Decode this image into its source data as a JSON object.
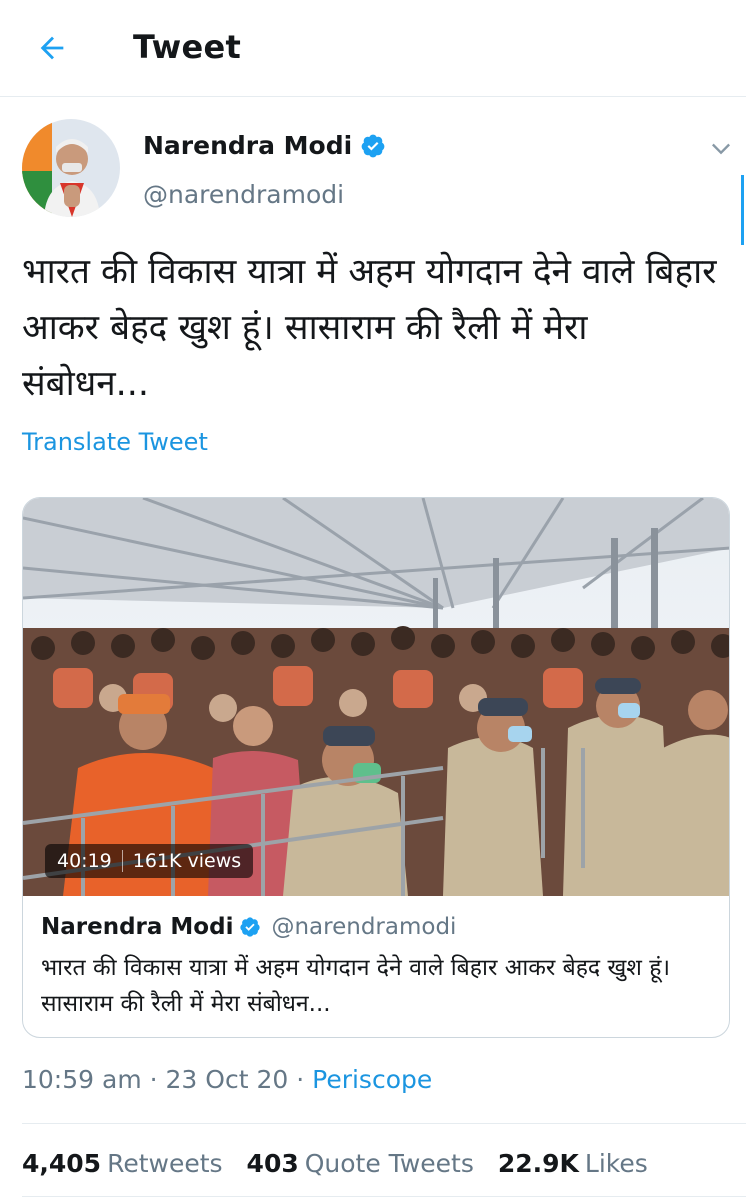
{
  "header": {
    "title": "Tweet",
    "back_icon": "arrow-left-icon"
  },
  "colors": {
    "accent": "#1da1f2",
    "link": "#1b95e0",
    "muted": "#657786",
    "text": "#14171a"
  },
  "tweet": {
    "author_name": "Narendra Modi",
    "author_handle": "@narendramodi",
    "text": "भारत की विकास यात्रा में अहम योगदान देने वाले बिहार आकर बेहद खुश हूं। सासाराम की रैली में मेरा संबोधन...",
    "translate_label": "Translate Tweet",
    "time": "10:59 am",
    "date": "23 Oct 20",
    "dot": "·",
    "source": "Periscope"
  },
  "card": {
    "duration": "40:19",
    "views": "161K views",
    "author_name": "Narendra Modi",
    "author_handle": "@narendramodi",
    "text": "भारत की विकास यात्रा में अहम योगदान देने वाले बिहार आकर बेहद खुश हूं। सासाराम की रैली में मेरा संबोधन..."
  },
  "stats": {
    "retweets_count": "4,405",
    "retweets_label": "Retweets",
    "quotes_count": "403",
    "quotes_label": "Quote Tweets",
    "likes_count": "22.9K",
    "likes_label": "Likes"
  }
}
